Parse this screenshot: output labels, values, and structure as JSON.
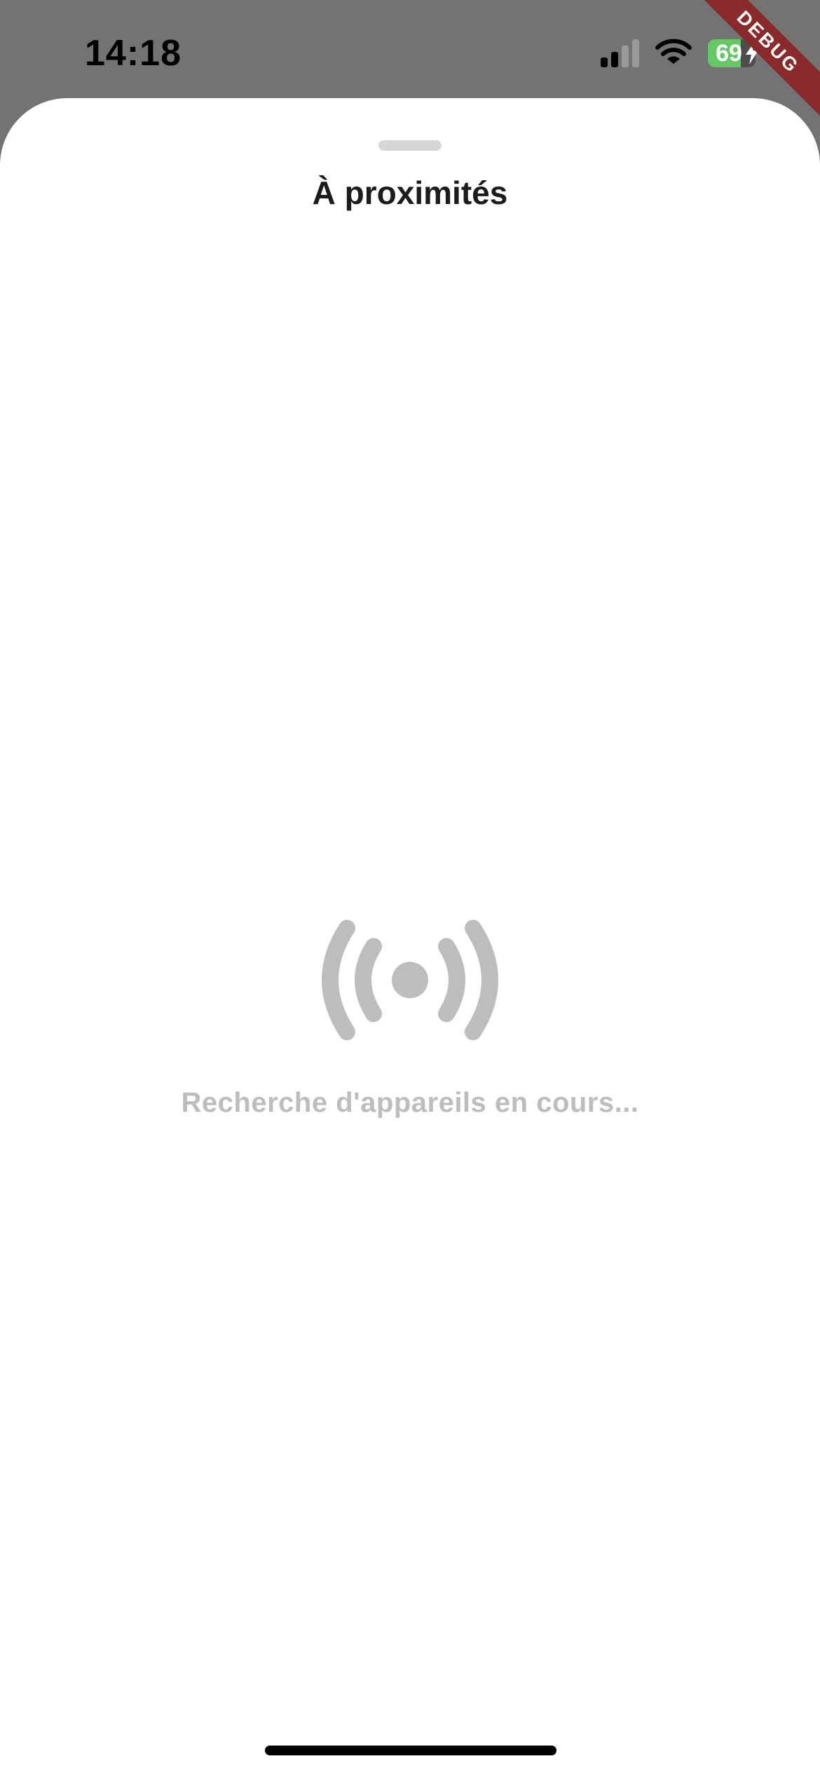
{
  "status_bar": {
    "time": "14:18",
    "battery_level": "69",
    "battery_fraction": 0.69,
    "icons": [
      "cellular-signal-icon",
      "wifi-icon",
      "battery-charging-icon"
    ]
  },
  "debug_banner": {
    "label": "DEBUG",
    "color": "#8b2a2a"
  },
  "sheet": {
    "title": "À proximités",
    "status_icon": "broadcast-icon",
    "status_text": "Recherche d'appareils en cours..."
  },
  "colors": {
    "backdrop": "#737373",
    "sheet_background": "#ffffff",
    "muted_text": "#bdbdbd",
    "battery_green": "#64c964"
  }
}
